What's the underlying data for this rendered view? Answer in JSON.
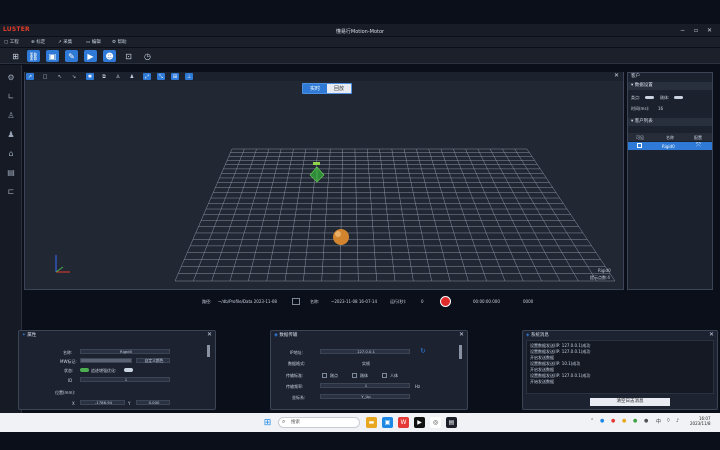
{
  "app": {
    "logo": "LUSTER",
    "title": "懂易行Motion-Motor",
    "win_controls": [
      "−",
      "▫",
      "✕"
    ]
  },
  "menu": [
    {
      "icon": "▢",
      "label": "工程"
    },
    {
      "icon": "⊕",
      "label": "标定"
    },
    {
      "icon": "↗",
      "label": "采集"
    },
    {
      "icon": "▭",
      "label": "编辑"
    },
    {
      "icon": "⚙",
      "label": "帮助"
    }
  ],
  "viewport": {
    "seg_live": "实时",
    "seg_replay": "回放",
    "label_1": "Rigid0",
    "label_2": "提示点数:4"
  },
  "right_panel": {
    "title": "客户",
    "section1": "数据设置",
    "fields": [
      {
        "label": "类点:",
        "label2": "刚体:"
      },
      {
        "label": "时间(ms):",
        "value": "16"
      }
    ],
    "section2": "客户列表",
    "table_headers": [
      "可见",
      "名称",
      "配置"
    ],
    "table_row": {
      "name": "Rigid0"
    }
  },
  "playback": {
    "path_label": "路径:",
    "path_value": "~/db/Profile/Data 2023-11-08",
    "name_label": "名称:",
    "name_value": "~2023-11-08 16-07-14",
    "duration_label": "运行(秒):",
    "duration_value": "0",
    "time": "00:00:00.000",
    "frames": "0000"
  },
  "attr_panel": {
    "title": "属性",
    "name_label": "名称:",
    "name_value": "Rigid0",
    "color_label": "MW标记:",
    "option_label": "自定义颜色",
    "track_label": "状态:",
    "track_text": "追迹增强优化:",
    "id_label": "ID",
    "id_value": "1",
    "pos_label": "位置(mm):",
    "x_label": "X",
    "x_value": "-1786.94",
    "y_label": "Y",
    "y_value": "0.000"
  },
  "transfer_panel": {
    "title": "数据传输",
    "ip_label": "IP地址:",
    "ip_value": "127.0.0.1",
    "proto_label": "数据格式:",
    "proto_value": "实帧",
    "mode_label": "传输标准:",
    "chk1": "刚点",
    "chk2": "刚体",
    "chk3": "人体",
    "rate_label": "传输频率:",
    "rate_value": "1",
    "rate_unit": "Hz",
    "coord_label": "坐标系:",
    "coord_value": "Y_Up"
  },
  "log_panel": {
    "title": "系统消息",
    "lines": [
      "设置数据发送(IP: 127.0.0.1)成功",
      "设置数据发送(IP: 127.0.0.1)成功",
      "开启发送数据",
      "设置数据发送(IP: 10.1)成功",
      "开启发送数据",
      "设置数据发送(IP: 127.0.0.1)成功",
      "开始发送数据"
    ],
    "button": "清空日志消息"
  },
  "taskbar": {
    "search_placeholder": "搜索",
    "time": "16:07",
    "date": "2023/11/8"
  },
  "colors": {
    "accent": "#2f7ad6",
    "logo": "#e53b2b",
    "record": "#e22b2b",
    "marker": "#d2852e",
    "rigid": "#4caf50"
  }
}
